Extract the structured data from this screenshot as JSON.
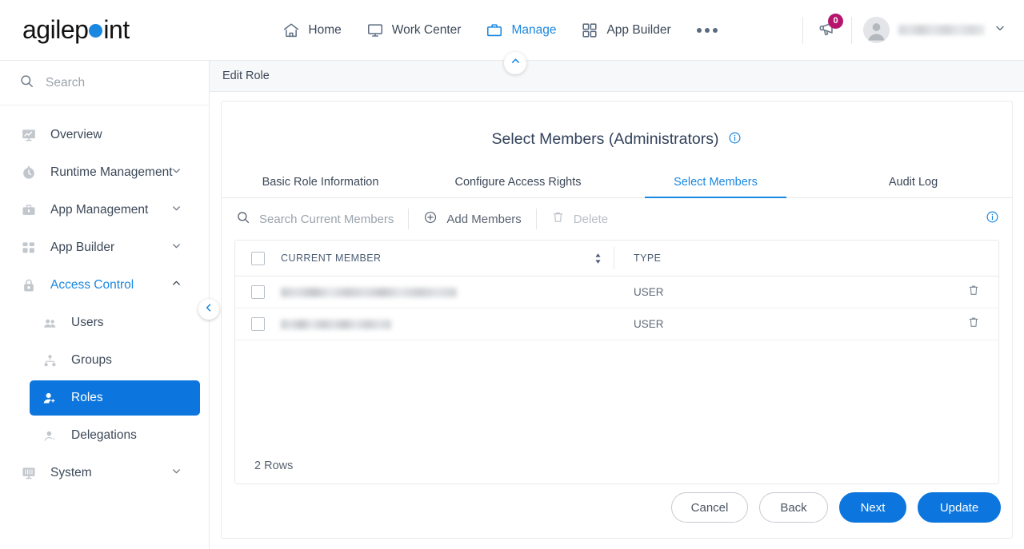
{
  "brand": {
    "name": "agilepoint",
    "accent": "#1a87e0"
  },
  "header": {
    "nav": [
      {
        "label": "Home",
        "icon": "home-icon",
        "active": false
      },
      {
        "label": "Work Center",
        "icon": "monitor-icon",
        "active": false
      },
      {
        "label": "Manage",
        "icon": "briefcase-icon",
        "active": true
      },
      {
        "label": "App Builder",
        "icon": "grid-icon",
        "active": false
      }
    ],
    "more_label": "more-options",
    "notification": {
      "icon": "megaphone-icon",
      "count": "0",
      "badge_color": "#b5156c"
    },
    "user": {
      "name": "",
      "avatar_icon": "user-avatar-icon",
      "chevron": "chevron-down-icon"
    }
  },
  "sidebar": {
    "search_placeholder": "Search",
    "items": [
      {
        "label": "Overview",
        "icon": "overview-icon",
        "expandable": false,
        "state": "normal"
      },
      {
        "label": "Runtime Management",
        "icon": "clock-icon",
        "expandable": true,
        "state": "normal"
      },
      {
        "label": "App Management",
        "icon": "briefcase-icon",
        "expandable": true,
        "state": "normal"
      },
      {
        "label": "App Builder",
        "icon": "grid-icon",
        "expandable": true,
        "state": "normal"
      },
      {
        "label": "Access Control",
        "icon": "lock-icon",
        "expandable": true,
        "state": "expanded"
      }
    ],
    "sub_items": [
      {
        "label": "Users",
        "icon": "users-icon",
        "selected": false
      },
      {
        "label": "Groups",
        "icon": "group-icon",
        "selected": false
      },
      {
        "label": "Roles",
        "icon": "role-icon",
        "selected": true
      },
      {
        "label": "Delegations",
        "icon": "delegation-icon",
        "selected": false
      }
    ],
    "tail_items": [
      {
        "label": "System",
        "icon": "system-icon",
        "expandable": true
      }
    ],
    "collapse_icon": "chevron-left-icon"
  },
  "main": {
    "breadcrumb": "Edit Role",
    "collapse_icon": "chevron-up-icon",
    "title": "Select Members (Administrators)",
    "title_info_icon": "info-icon",
    "tabs": [
      {
        "label": "Basic Role Information",
        "active": false
      },
      {
        "label": "Configure Access Rights",
        "active": false
      },
      {
        "label": "Select Members",
        "active": true
      },
      {
        "label": "Audit Log",
        "active": false
      }
    ],
    "toolbar": {
      "search_placeholder": "Search Current Members",
      "search_icon": "search-icon",
      "add_label": "Add Members",
      "add_icon": "plus-circle-icon",
      "delete_label": "Delete",
      "delete_icon": "trash-icon",
      "delete_disabled": true,
      "info_icon": "info-icon"
    },
    "table": {
      "columns": [
        "CURRENT MEMBER",
        "TYPE"
      ],
      "sort_icon": "sort-arrows-icon",
      "rows": [
        {
          "member": "",
          "member_redacted": true,
          "type": "USER",
          "delete_icon": "trash-icon"
        },
        {
          "member": "",
          "member_redacted": true,
          "type": "USER",
          "delete_icon": "trash-icon"
        }
      ],
      "footer": "2 Rows"
    },
    "actions": [
      {
        "label": "Cancel",
        "style": "ghost"
      },
      {
        "label": "Back",
        "style": "ghost"
      },
      {
        "label": "Next",
        "style": "primary"
      },
      {
        "label": "Update",
        "style": "primary"
      }
    ]
  }
}
